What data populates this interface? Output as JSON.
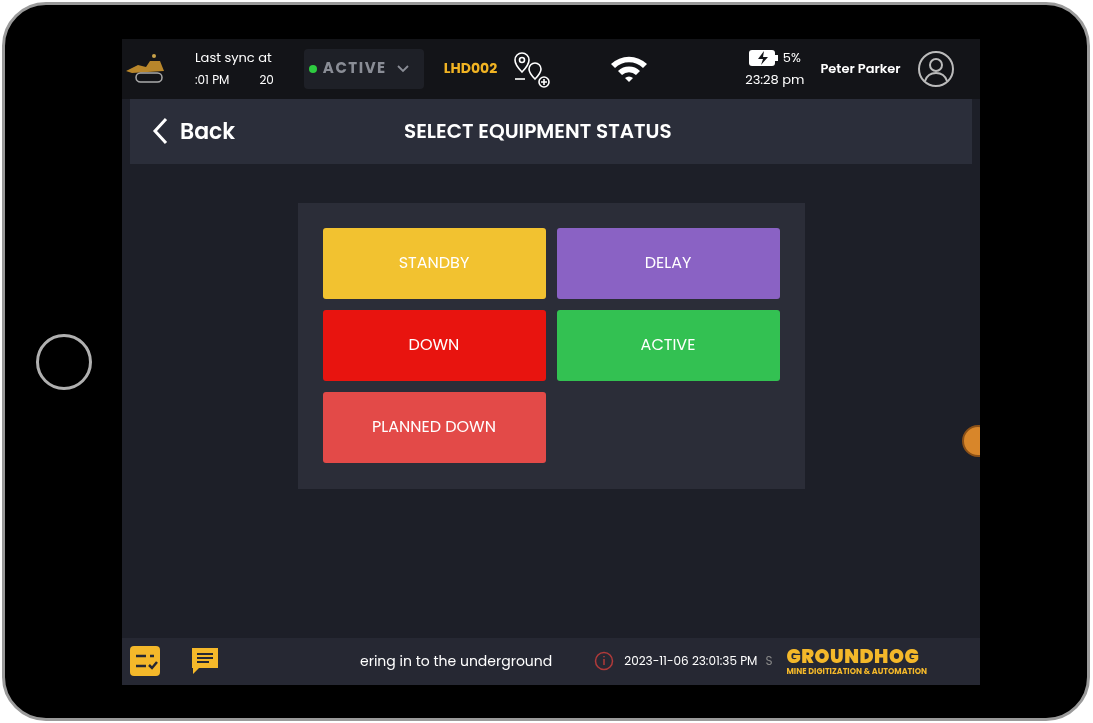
{
  "top_bar": {
    "sync_label": "Last sync at",
    "sync_time": ":01 PM",
    "sync_date": "20",
    "status": {
      "label": "ACTIVE",
      "color": "#2ecc40"
    },
    "equipment_id": "LHD002",
    "battery": "5%",
    "time": "23:28 pm",
    "user": "Peter Parker"
  },
  "header": {
    "back": "Back",
    "title": "SELECT EQUIPMENT STATUS"
  },
  "statuses": [
    {
      "label": "STANDBY",
      "color": "#f2c230"
    },
    {
      "label": "DELAY",
      "color": "#8a62c4"
    },
    {
      "label": "DOWN",
      "color": "#e8140f"
    },
    {
      "label": "ACTIVE",
      "color": "#33c152"
    },
    {
      "label": "PLANNED DOWN",
      "color": "#e34a48"
    }
  ],
  "bottom_bar": {
    "ticker": "ering in to the underground",
    "timestamp": "2023-11-06 23:01:35 PM",
    "timestamp_tail": "S",
    "brand": "GROUNDHOG",
    "tagline": "MINE DIGITIZATION & AUTOMATION"
  }
}
